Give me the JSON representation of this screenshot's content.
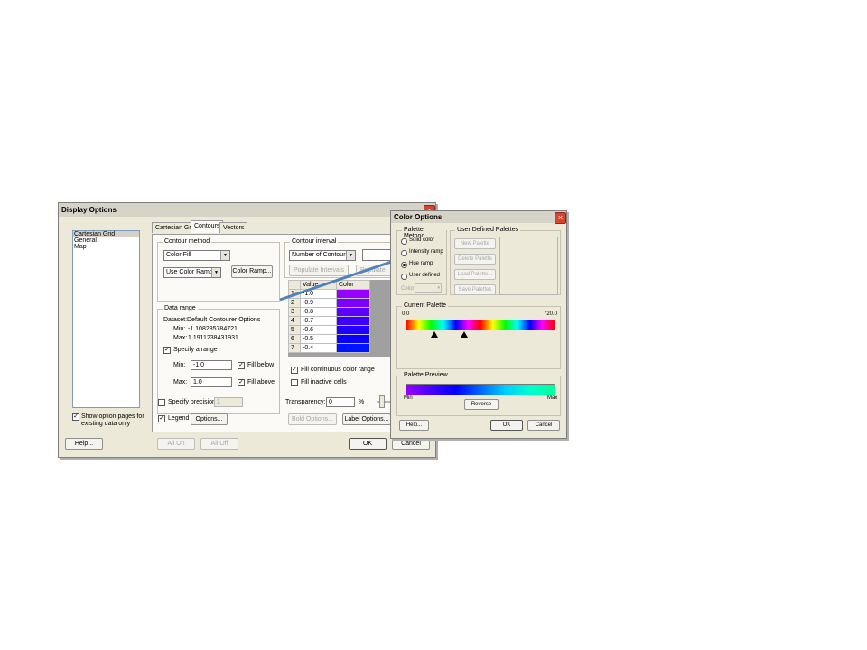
{
  "display_options": {
    "title": "Display Options",
    "tree_items": [
      "Cartesian Grid",
      "General",
      "Map"
    ],
    "show_pages_label_1": "Show option pages for",
    "show_pages_label_2": "existing data only",
    "help": "Help...",
    "all_on": "All On",
    "all_off": "All Off",
    "ok": "OK",
    "cancel": "Cancel",
    "tabs": [
      "Cartesian Grid",
      "Contours",
      "Vectors"
    ],
    "contour_method": {
      "legend": "Contour method",
      "method_value": "Color Fill",
      "ramp_value": "Use Color Ramp",
      "color_ramp_button": "Color Ramp..."
    },
    "data_range": {
      "legend": "Data range",
      "dataset_label": "Dataset:",
      "dataset_value": "Default Contourer Options",
      "min_label": "Min:",
      "min_value": "-1.108285784721",
      "max_label": "Max:",
      "max_value": "1.1911238431931",
      "specify_range": "Specify a range",
      "min_input_label": "Min:",
      "min_input": "-1.0",
      "max_input_label": "Max:",
      "max_input": "1.0",
      "fill_below": "Fill below",
      "fill_above": "Fill above"
    },
    "specify_precision": "Specify precision",
    "precision_value": "1",
    "legend_label": "Legend",
    "options_button": "Options...",
    "contour_interval": {
      "legend": "Contour interval",
      "mode_value": "Number of Contours",
      "populate_button": "Populate Li",
      "partial_button": "Populate Intervals"
    },
    "table_headers": [
      "Value",
      "Color"
    ],
    "table_rows": [
      {
        "n": "1",
        "value": "-1.0",
        "color": "#9900ff"
      },
      {
        "n": "2",
        "value": "-0.9",
        "color": "#7a00ff"
      },
      {
        "n": "3",
        "value": "-0.8",
        "color": "#5a00ff"
      },
      {
        "n": "4",
        "value": "-0.7",
        "color": "#3d00ff"
      },
      {
        "n": "5",
        "value": "-0.6",
        "color": "#2200ff"
      },
      {
        "n": "6",
        "value": "-0.5",
        "color": "#0a00ff"
      },
      {
        "n": "7",
        "value": "-0.4",
        "color": "#0014ff"
      }
    ],
    "fill_continuous": "Fill continuous color range",
    "fill_inactive": "Fill inactive cells",
    "transparency_label": "Transparency:",
    "transparency_value": "0",
    "percent": "%",
    "bold_options": "Bold Options...",
    "label_options": "Label Options..."
  },
  "color_options": {
    "title": "Color Options",
    "palette_method": {
      "legend": "Palette Method",
      "solid": "Solid color",
      "intensity": "Intensity ramp",
      "hue": "Hue ramp",
      "user": "User defined",
      "color_label": "Color:"
    },
    "user_defined": {
      "legend": "User Defined Palettes",
      "new": "New Palette",
      "delete": "Delete Palette",
      "load": "Load Palette...",
      "save": "Save Palettes"
    },
    "current_palette": {
      "legend": "Current Palette",
      "min": "0.0",
      "max": "720.0"
    },
    "palette_preview": {
      "legend": "Palette Preview",
      "min": "Min",
      "max": "Max",
      "reverse": "Reverse"
    },
    "help": "Help...",
    "ok": "OK",
    "cancel": "Cancel"
  },
  "colors": {
    "arrow": "#4f81bd"
  }
}
